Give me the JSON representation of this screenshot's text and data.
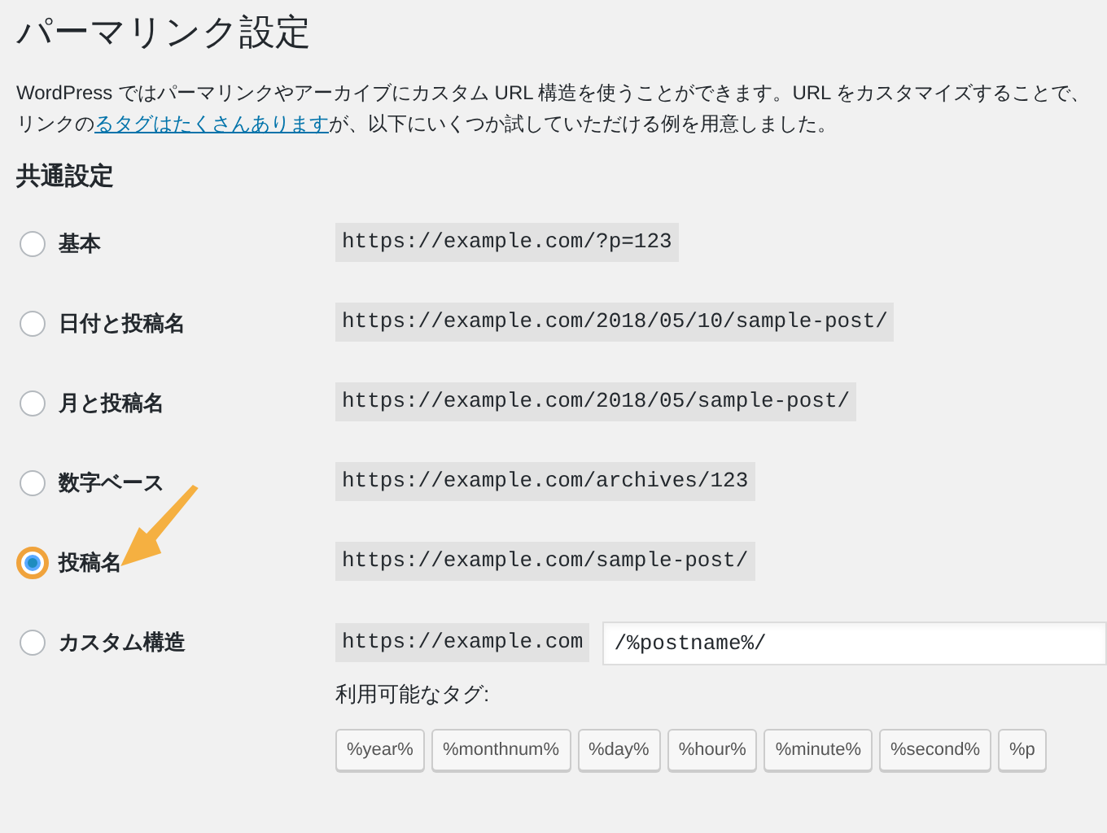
{
  "title": "パーマリンク設定",
  "description": {
    "before": "WordPress ではパーマリンクやアーカイブにカスタム URL 構造を使うことができます。URL をカスタマイズすることで、リンクの",
    "link": "るタグはたくさんあります",
    "after": "が、以下にいくつか試していただける例を用意しました。"
  },
  "section_title": "共通設定",
  "options": [
    {
      "label": "基本",
      "kind": "example",
      "url": "https://example.com/?p=123",
      "selected": false
    },
    {
      "label": "日付と投稿名",
      "kind": "example",
      "url": "https://example.com/2018/05/10/sample-post/",
      "selected": false
    },
    {
      "label": "月と投稿名",
      "kind": "example",
      "url": "https://example.com/2018/05/sample-post/",
      "selected": false
    },
    {
      "label": "数字ベース",
      "kind": "example",
      "url": "https://example.com/archives/123",
      "selected": false
    },
    {
      "label": "投稿名",
      "kind": "example",
      "url": "https://example.com/sample-post/",
      "selected": true
    },
    {
      "label": "カスタム構造",
      "kind": "custom",
      "url": "https://example.com",
      "value": "/%postname%/",
      "selected": false
    }
  ],
  "tags_label": "利用可能なタグ:",
  "tags": [
    "%year%",
    "%monthnum%",
    "%day%",
    "%hour%",
    "%minute%",
    "%second%",
    "%p"
  ]
}
